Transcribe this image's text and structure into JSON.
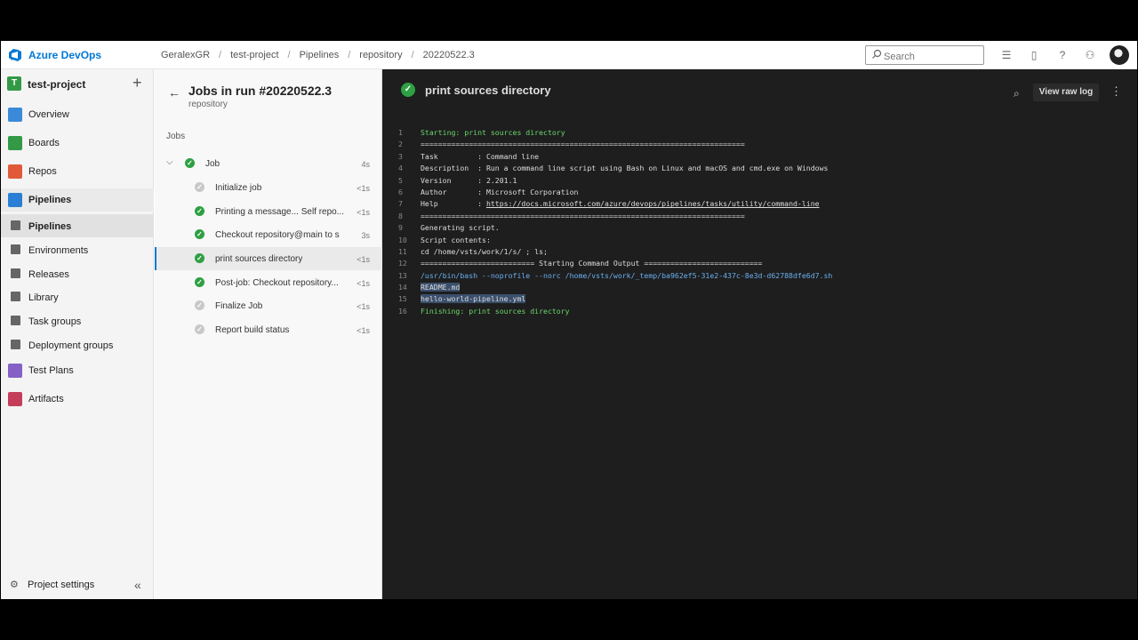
{
  "topbar": {
    "brand": "Azure DevOps",
    "breadcrumbs": [
      "GeralexGR",
      "test-project",
      "Pipelines",
      "repository",
      "20220522.3"
    ],
    "search_placeholder": "Search",
    "icons": [
      "list-icon",
      "shopping-bag-icon",
      "help-icon",
      "user-settings-icon"
    ]
  },
  "sidebar": {
    "project_initial": "T",
    "project_name": "test-project",
    "items": [
      {
        "label": "Overview",
        "icon": "overview-icon",
        "color": "#3b8ad9"
      },
      {
        "label": "Boards",
        "icon": "boards-icon",
        "color": "#339947"
      },
      {
        "label": "Repos",
        "icon": "repos-icon",
        "color": "#e05a3a"
      },
      {
        "label": "Pipelines",
        "icon": "pipelines-icon",
        "color": "#2a7fd4"
      },
      {
        "label": "Test Plans",
        "icon": "test-plans-icon",
        "color": "#8661c5"
      },
      {
        "label": "Artifacts",
        "icon": "artifacts-icon",
        "color": "#c43e5c"
      }
    ],
    "sub_items": [
      {
        "label": "Pipelines"
      },
      {
        "label": "Environments"
      },
      {
        "label": "Releases"
      },
      {
        "label": "Library"
      },
      {
        "label": "Task groups"
      },
      {
        "label": "Deployment groups"
      }
    ],
    "settings_label": "Project settings"
  },
  "jobs": {
    "title": "Jobs in run #20220522.3",
    "subtitle": "repository",
    "section_label": "Jobs",
    "job": {
      "label": "Job",
      "time": "4s"
    },
    "steps": [
      {
        "label": "Initialize job",
        "time": "<1s",
        "status": "skipped"
      },
      {
        "label": "Printing a message... Self repo...",
        "time": "<1s",
        "status": "succeeded"
      },
      {
        "label": "Checkout repository@main to s",
        "time": "3s",
        "status": "succeeded"
      },
      {
        "label": "print sources directory",
        "time": "<1s",
        "status": "succeeded"
      },
      {
        "label": "Post-job: Checkout repository...",
        "time": "<1s",
        "status": "succeeded"
      },
      {
        "label": "Finalize Job",
        "time": "<1s",
        "status": "skipped"
      },
      {
        "label": "Report build status",
        "time": "<1s",
        "status": "skipped"
      }
    ]
  },
  "log": {
    "title": "print sources directory",
    "view_raw_label": "View raw log",
    "lines": [
      {
        "no": "1",
        "text": "Starting: print sources directory"
      },
      {
        "no": "2",
        "text": "=========================================================================="
      },
      {
        "no": "3",
        "text": "Task         : Command line"
      },
      {
        "no": "4",
        "text": "Description  : Run a command line script using Bash on Linux and macOS and cmd.exe on Windows"
      },
      {
        "no": "5",
        "text": "Version      : 2.201.1"
      },
      {
        "no": "6",
        "text": "Author       : Microsoft Corporation"
      },
      {
        "no": "7",
        "prefix": "Help         : ",
        "link": "https://docs.microsoft.com/azure/devops/pipelines/tasks/utility/command-line"
      },
      {
        "no": "8",
        "text": "=========================================================================="
      },
      {
        "no": "9",
        "text": "Generating script."
      },
      {
        "no": "10",
        "text": "Script contents:"
      },
      {
        "no": "11",
        "text": "cd /home/vsts/work/1/s/ ; ls;"
      },
      {
        "no": "12",
        "text": "========================== Starting Command Output ==========================="
      },
      {
        "no": "13",
        "text": "/usr/bin/bash --noprofile --norc /home/vsts/work/_temp/ba962ef5-31e2-437c-8e3d-d62788dfe6d7.sh"
      },
      {
        "no": "14",
        "text": "README.md"
      },
      {
        "no": "15",
        "text": "hello-world-pipeline.yml"
      },
      {
        "no": "16",
        "text": "Finishing: print sources directory"
      }
    ]
  },
  "colors": {
    "success": "#2ea043",
    "accent": "#0078d4",
    "log_bg": "#1e1e1e"
  }
}
